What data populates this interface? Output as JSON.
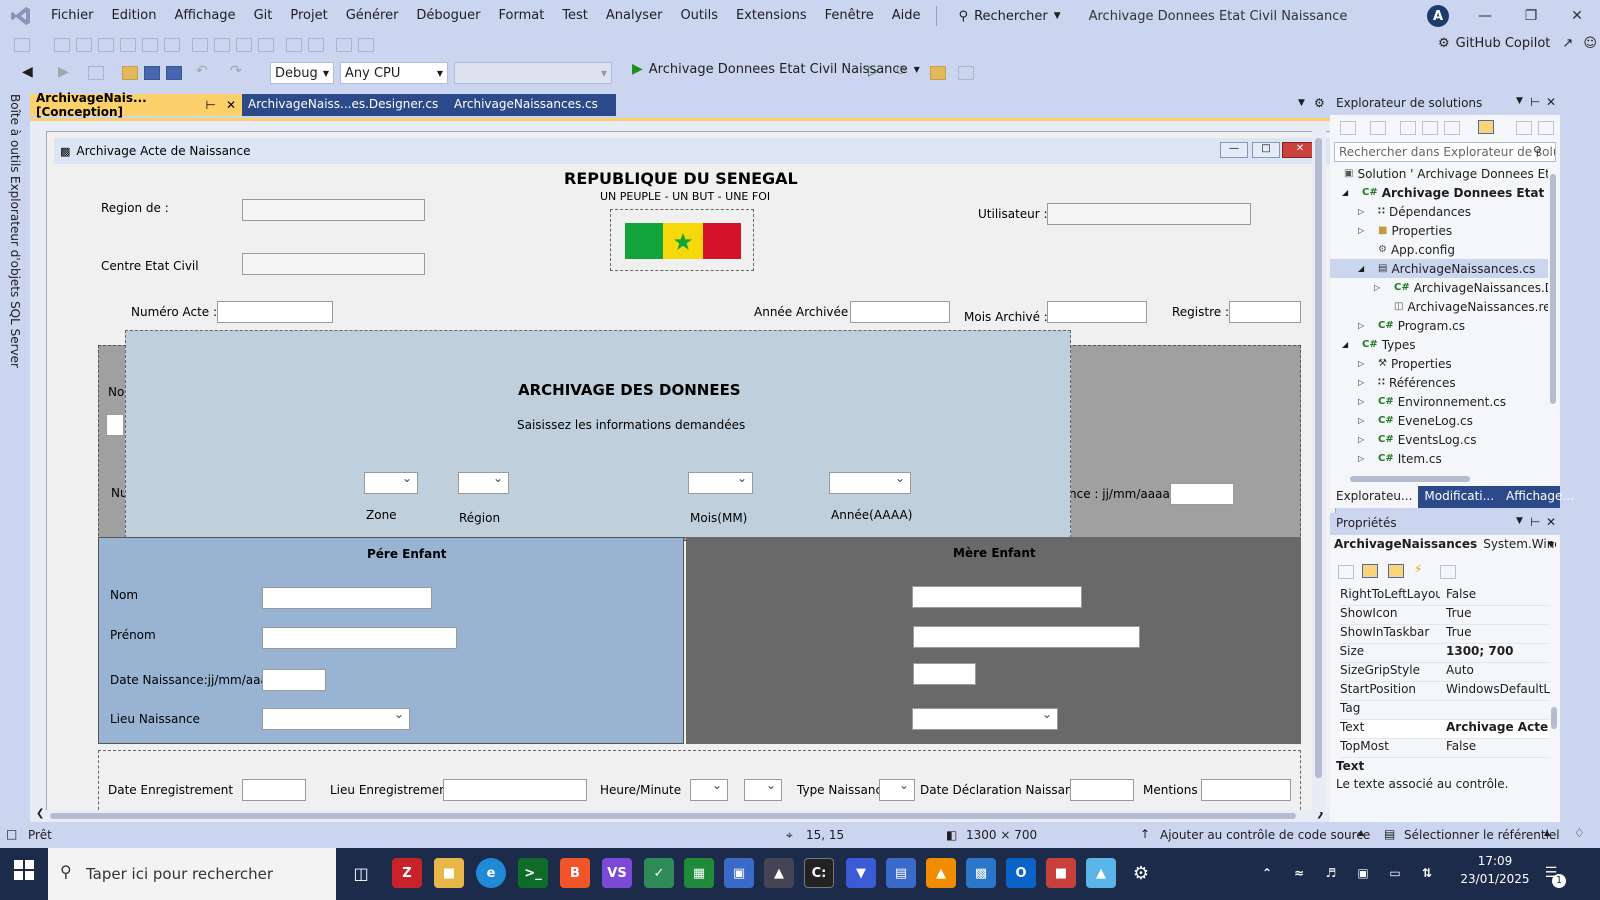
{
  "menubar": {
    "items": [
      "Fichier",
      "Edition",
      "Affichage",
      "Git",
      "Projet",
      "Générer",
      "Déboguer",
      "Format",
      "Test",
      "Analyser",
      "Outils",
      "Extensions",
      "Fenêtre",
      "Aide"
    ],
    "search_label": "Rechercher",
    "solution_title": "Archivage Donnees Etat Civil Naissance",
    "avatar_letter": "A"
  },
  "toolbar": {
    "copilot_label": "GitHub Copilot",
    "config": "Debug",
    "platform": "Any CPU",
    "run_label": "Archivage Donnees Etat Civil Naissance"
  },
  "left_strip": {
    "tab1": "Boîte à outils",
    "tab2": "Explorateur d'objets SQL Server"
  },
  "doc_tabs": [
    {
      "label": "ArchivageNais... [Conception]"
    },
    {
      "label": "ArchivageNaiss...es.Designer.cs"
    },
    {
      "label": "ArchivageNaissances.cs"
    }
  ],
  "form": {
    "title": "Archivage Acte de Naissance",
    "republic": "REPUBLIQUE DU SENEGAL",
    "motto": "UN PEUPLE - UN BUT - UNE FOI",
    "region_label": "Region de :",
    "centre_label": "Centre Etat Civil",
    "utilisateur_label": "Utilisateur :",
    "numero_label": "Numéro Acte :",
    "annee_archivee_label": "Année Archivée :",
    "mois_archive_label": "Mois Archivé :",
    "registre_label": "Registre :",
    "hidden_no_label": "No",
    "hidden_nu_label": "Nu",
    "hidden_date_label": "nce : jj/mm/aaaa",
    "overlay": {
      "title": "ARCHIVAGE DES DONNEES",
      "subtitle": "Saisissez  les informations demandées",
      "zone_label": "Zone",
      "region_label": "Région",
      "mois_label": "Mois(MM)",
      "annee_label": "Année(AAAA)"
    },
    "pere": {
      "title": "Pére Enfant",
      "nom": "Nom",
      "prenom": "Prénom",
      "date_naissance": "Date Naissance:jj/mm/aaaa",
      "lieu_naissance": "Lieu Naissance"
    },
    "mere": {
      "title": "Mère Enfant"
    },
    "bottom": {
      "date_enregistrement": "Date Enregistrement",
      "lieu_enregistrement": "Lieu Enregistrement",
      "heure_minute": "Heure/Minute",
      "type_naissance": "Type Naissance",
      "date_declaration": "Date Déclaration Naissance",
      "mentions": "Mentions"
    }
  },
  "solution_explorer": {
    "title": "Explorateur de solutions",
    "search_placeholder": "Rechercher dans Explorateur de solu",
    "items": [
      {
        "label": "Solution ' Archivage Donnees Etat (",
        "indent": 0,
        "arrow": ""
      },
      {
        "label": "Archivage Donnees Etat Civil N",
        "indent": 1,
        "arrow": "◢",
        "bold": true
      },
      {
        "label": "Dépendances",
        "indent": 2,
        "arrow": "▷"
      },
      {
        "label": "Properties",
        "indent": 2,
        "arrow": "▷"
      },
      {
        "label": "App.config",
        "indent": 2,
        "arrow": ""
      },
      {
        "label": "ArchivageNaissances.cs",
        "indent": 2,
        "arrow": "◢",
        "selected": true
      },
      {
        "label": "ArchivageNaissances.De",
        "indent": 3,
        "arrow": "▷"
      },
      {
        "label": "ArchivageNaissances.res",
        "indent": 3,
        "arrow": ""
      },
      {
        "label": "Program.cs",
        "indent": 2,
        "arrow": "▷"
      },
      {
        "label": "Types",
        "indent": 1,
        "arrow": "◢"
      },
      {
        "label": "Properties",
        "indent": 2,
        "arrow": "▷"
      },
      {
        "label": "Références",
        "indent": 2,
        "arrow": "▷"
      },
      {
        "label": "Environnement.cs",
        "indent": 2,
        "arrow": "▷"
      },
      {
        "label": "EveneLog.cs",
        "indent": 2,
        "arrow": "▷"
      },
      {
        "label": "EventsLog.cs",
        "indent": 2,
        "arrow": "▷"
      },
      {
        "label": "Item.cs",
        "indent": 2,
        "arrow": "▷"
      }
    ],
    "tabs": [
      "Explorateu...",
      "Modificati...",
      "Affichage..."
    ]
  },
  "properties": {
    "title": "Propriétés",
    "object": "ArchivageNaissances",
    "object_type": "System.Windows.",
    "rows": [
      {
        "name": "RightToLeftLayou",
        "value": "False"
      },
      {
        "name": "ShowIcon",
        "value": "True"
      },
      {
        "name": "ShowInTaskbar",
        "value": "True"
      },
      {
        "name": "Size",
        "value": "1300; 700",
        "bold": true
      },
      {
        "name": "SizeGripStyle",
        "value": "Auto"
      },
      {
        "name": "StartPosition",
        "value": "WindowsDefaultLo"
      },
      {
        "name": "Tag",
        "value": ""
      },
      {
        "name": "Text",
        "value": "Archivage Acte de",
        "bold": true
      },
      {
        "name": "TopMost",
        "value": "False"
      }
    ],
    "desc_title": "Text",
    "desc_text": "Le texte associé au contrôle."
  },
  "statusbar": {
    "ready": "Prêt",
    "position": "15, 15",
    "size": "1300 × 700",
    "source_control": "Ajouter au contrôle de code source",
    "repo": "Sélectionner le référentiel",
    "notif": "1"
  },
  "taskbar": {
    "search_placeholder": "Taper ici pour rechercher",
    "time": "17:09",
    "date": "23/01/2025"
  }
}
